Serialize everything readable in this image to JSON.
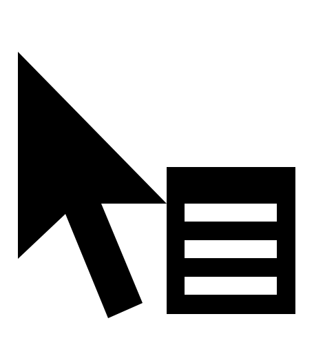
{
  "icon": {
    "name": "context-menu-cursor-icon",
    "parts": [
      "mouse-pointer-icon",
      "menu-list-icon"
    ],
    "color": "#000000",
    "background": "#ffffff"
  }
}
